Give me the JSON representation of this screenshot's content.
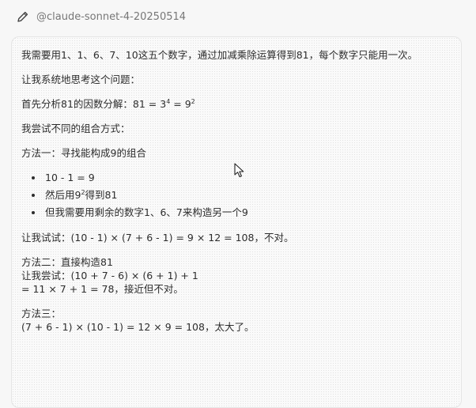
{
  "header": {
    "model": "@claude-sonnet-4-20250514",
    "icon": "pencil-icon"
  },
  "message": {
    "problem": "我需要用1、1、6、7、10这五个数字，通过加减乘除运算得到81，每个数字只能用一次。",
    "intro": "让我系统地思考这个问题：",
    "factor_prefix": "首先分析81的因数分解：81 = 3",
    "factor_exp1": "4",
    "factor_mid": " = 9",
    "factor_exp2": "2",
    "try_intro": "我尝试不同的组合方式：",
    "method1_title": "方法一：寻找能构成9的组合",
    "bullet1": "10 - 1 = 9",
    "bullet2_prefix": "然后用9",
    "bullet2_exp": "2",
    "bullet2_suffix": "得到81",
    "bullet3": "但我需要用剩余的数字1、6、7来构造另一个9",
    "try1": "让我试试：(10 - 1) × (7 + 6 - 1) = 9 × 12 = 108，不对。",
    "method2_title": "方法二：直接构造81",
    "method2_line2": "让我尝试：(10 + 7 - 6) × (6 + 1) + 1",
    "method2_line3": "= 11 × 7 + 1 = 78，接近但不对。",
    "method3_title": "方法三：",
    "method3_line2": "(7 + 6 - 1) × (10 - 1) = 12 × 9 = 108，太大了。"
  }
}
